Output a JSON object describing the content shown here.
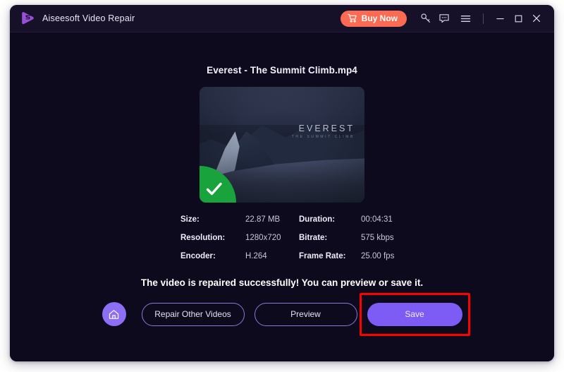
{
  "window": {
    "title": "Aiseesoft Video Repair",
    "logo_icon": "aiseesoft-play-logo"
  },
  "titlebar": {
    "buy_now_label": "Buy Now",
    "cart_icon": "shopping-cart-icon",
    "key_icon": "key-icon",
    "feedback_icon": "chat-bubble-icon",
    "menu_icon": "hamburger-menu-icon",
    "minimize_icon": "minimize-icon",
    "maximize_icon": "maximize-icon",
    "close_icon": "close-icon"
  },
  "main": {
    "file_name": "Everest - The Summit Climb.mp4",
    "thumbnail": {
      "overlay_title": "EVEREST",
      "overlay_subtitle": "THE SUMMIT CLIMB",
      "badge_icon": "green-checkmark-badge"
    },
    "metadata": [
      {
        "label": "Size:",
        "value": "22.87 MB",
        "label2": "Duration:",
        "value2": "00:04:31"
      },
      {
        "label": "Resolution:",
        "value": "1280x720",
        "label2": "Bitrate:",
        "value2": "575 kbps"
      },
      {
        "label": "Encoder:",
        "value": "H.264",
        "label2": "Frame Rate:",
        "value2": "25.00 fps"
      }
    ],
    "status_message": "The video is repaired successfully! You can preview or save it.",
    "actions": {
      "home_icon": "home-icon",
      "repair_other_label": "Repair Other Videos",
      "preview_label": "Preview",
      "save_label": "Save"
    }
  },
  "colors": {
    "window_background": "#0e0a1e",
    "titlebar_background": "#161129",
    "accent_purple": "#7d5cf6",
    "buy_now_orange": "#fb6a53",
    "success_green": "#18a33d",
    "highlight_red": "#ff0000"
  }
}
